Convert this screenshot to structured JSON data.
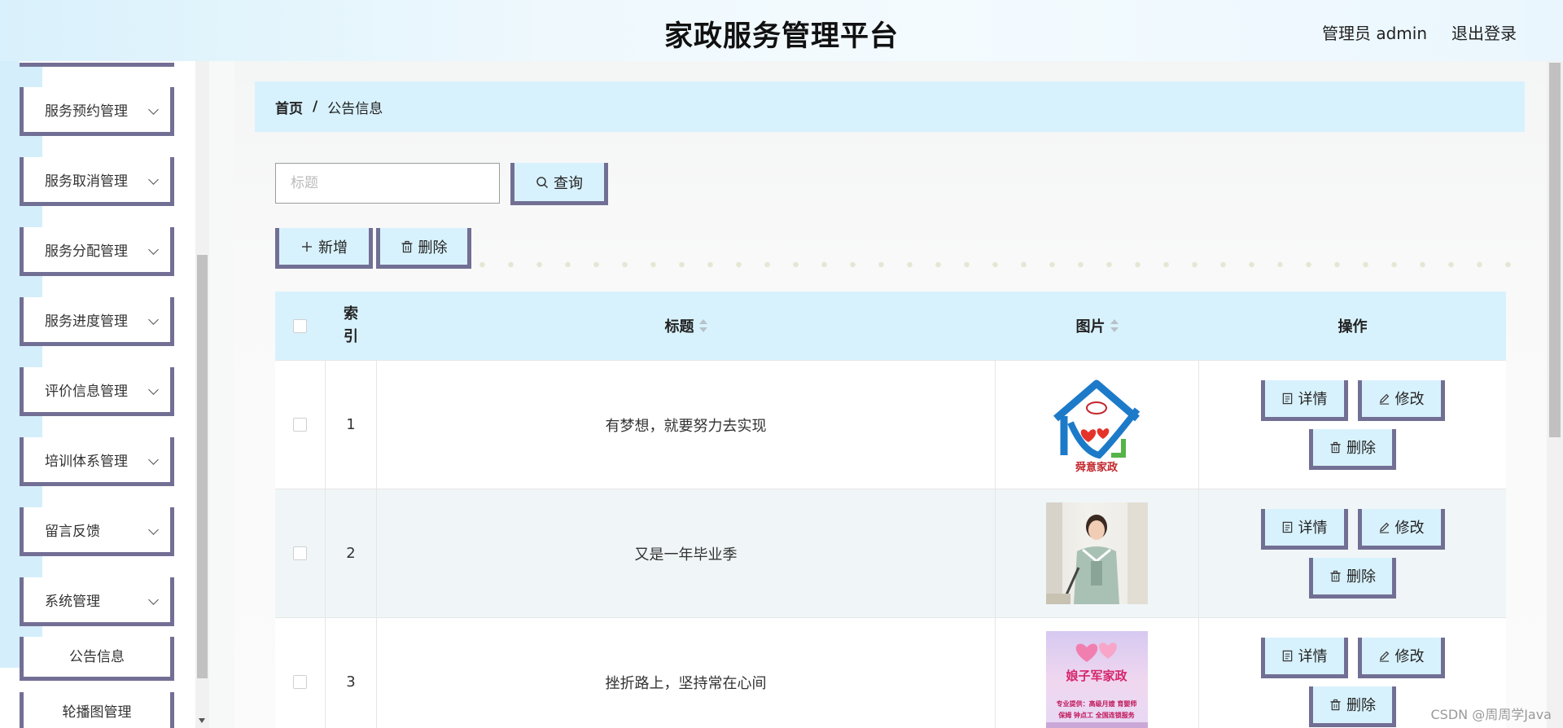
{
  "header": {
    "title": "家政服务管理平台",
    "user": "管理员 admin",
    "logout": "退出登录"
  },
  "sidebar": {
    "items": [
      {
        "label": "服务预约管理"
      },
      {
        "label": "服务取消管理"
      },
      {
        "label": "服务分配管理"
      },
      {
        "label": "服务进度管理"
      },
      {
        "label": "评价信息管理"
      },
      {
        "label": "培训体系管理"
      },
      {
        "label": "留言反馈"
      },
      {
        "label": "系统管理"
      }
    ],
    "subitems": [
      {
        "label": "公告信息"
      },
      {
        "label": "轮播图管理"
      }
    ]
  },
  "breadcrumb": {
    "home": "首页",
    "separator": "/",
    "current": "公告信息"
  },
  "search": {
    "placeholder": "标题",
    "button": "查询"
  },
  "actions": {
    "add": "新增",
    "delete": "删除"
  },
  "table": {
    "headers": {
      "index": "索\n引",
      "title": "标题",
      "image": "图片",
      "ops": "操作"
    },
    "rows": [
      {
        "index": "1",
        "title": "有梦想，就要努力去实现"
      },
      {
        "index": "2",
        "title": "又是一年毕业季"
      },
      {
        "index": "3",
        "title": "挫折路上，坚持常在心间"
      }
    ],
    "row_buttons": {
      "detail": "详情",
      "edit": "修改",
      "delete": "删除"
    },
    "image_texts": {
      "logo": "舜意家政",
      "poster_title": "娘子军家政",
      "poster_line1": "专业提供：高级月嫂  育婴师",
      "poster_line2": "保姆  钟点工  全国连锁服务"
    }
  },
  "watermark": "CSDN @周周学Java",
  "colors": {
    "accent": "#726f95",
    "light_blue": "#d8f2fd",
    "header_bg": "#e9f6fd"
  }
}
